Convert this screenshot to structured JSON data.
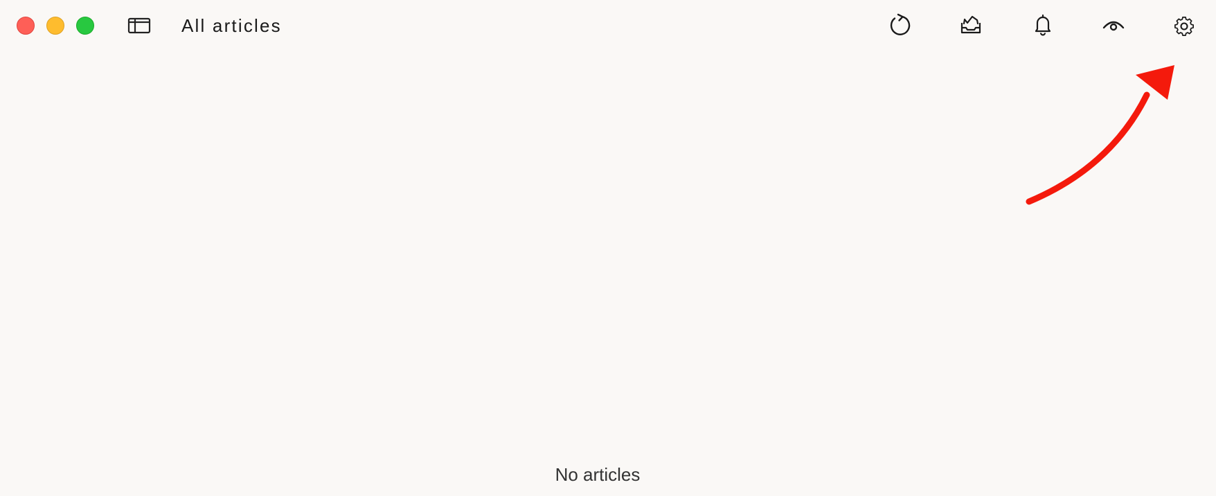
{
  "window": {
    "title": "All articles",
    "controls": [
      "close",
      "minimize",
      "zoom"
    ],
    "colors": {
      "close": "#fe5f57",
      "minimize": "#febc2e",
      "zoom": "#28c840",
      "background": "#faf8f6",
      "annotation": "#f41a0c"
    }
  },
  "toolbar": {
    "sidebar_toggle_icon": "sidebar-icon",
    "buttons": [
      {
        "name": "refresh-button",
        "icon": "refresh-icon"
      },
      {
        "name": "mark-all-read-button",
        "icon": "tray-check-icon"
      },
      {
        "name": "notifications-button",
        "icon": "bell-icon"
      },
      {
        "name": "visibility-button",
        "icon": "eye-icon"
      },
      {
        "name": "settings-button",
        "icon": "gear-icon"
      }
    ]
  },
  "main": {
    "empty_message": "No articles"
  },
  "annotation": {
    "icon": "red-arrow-icon",
    "points_to": "settings-button"
  }
}
